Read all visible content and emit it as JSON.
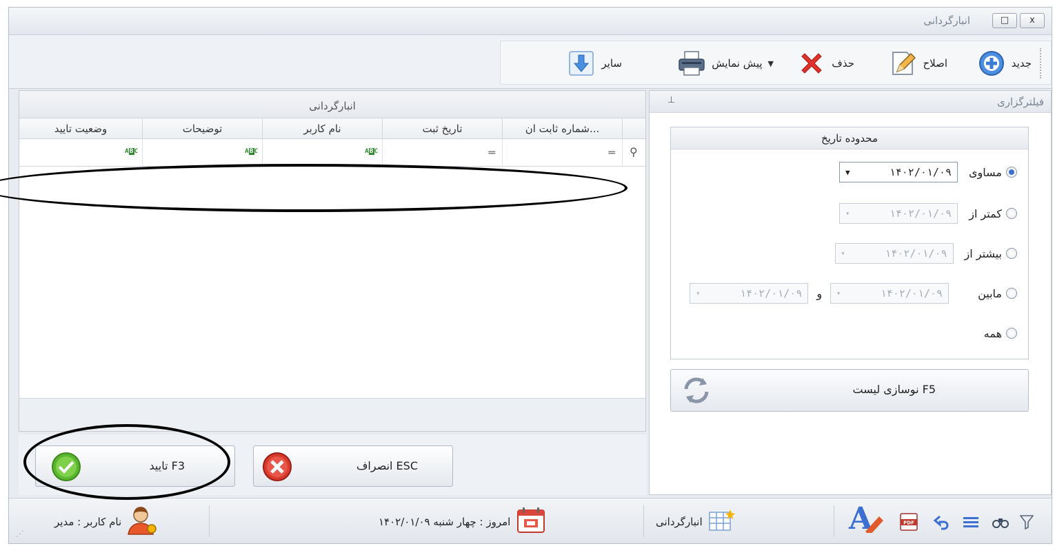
{
  "window": {
    "title": "انبارگردانی",
    "close_label": "x",
    "restore_label": "□"
  },
  "toolbar": {
    "new_label": "جدید",
    "edit_label": "اصلاح",
    "delete_label": "حذف",
    "preview_label": "پیش نمایش",
    "other_label": "سایر"
  },
  "filter": {
    "title": "فیلترگزاری",
    "pin_icon": "pin-icon",
    "range_title": "محدوده تاریخ",
    "options": [
      {
        "label": "مساوی",
        "selected": true,
        "value": "۱۴۰۲/۰۱/۰۹"
      },
      {
        "label": "کمتر از",
        "selected": false,
        "value": "۱۴۰۲/۰۱/۰۹"
      },
      {
        "label": "بیشتر از",
        "selected": false,
        "value": "۱۴۰۲/۰۱/۰۹"
      },
      {
        "label": "مابین",
        "selected": false,
        "value": "۱۴۰۲/۰۱/۰۹",
        "value2": "۱۴۰۲/۰۱/۰۹",
        "and": "و"
      },
      {
        "label": "همه",
        "selected": false
      }
    ],
    "refresh_label": "نوسازی لیست  F5"
  },
  "grid": {
    "group_title": "انبارگردانی",
    "columns": [
      "شماره ثابت ان...",
      "تاریخ ثبت",
      "نام کاربر",
      "توضیحات",
      "وضعیت تایید"
    ],
    "filter_ops": [
      "═",
      "═",
      "ABC",
      "ABC",
      "ABC"
    ],
    "rows": []
  },
  "buttons": {
    "confirm_label": "تایید  F3",
    "cancel_label": "انصراف  ESC"
  },
  "status": {
    "user_label": "نام کاربر : مدیر",
    "today_label": "امروز : چهار شنبه  ۱۴۰۲/۰۱/۰۹",
    "module_label": "انبارگردانی"
  },
  "colors": {
    "accent": "#3b6fd1",
    "confirm_green": "#5cb531",
    "cancel_red": "#d83b2b",
    "delete_red": "#e0312a"
  }
}
